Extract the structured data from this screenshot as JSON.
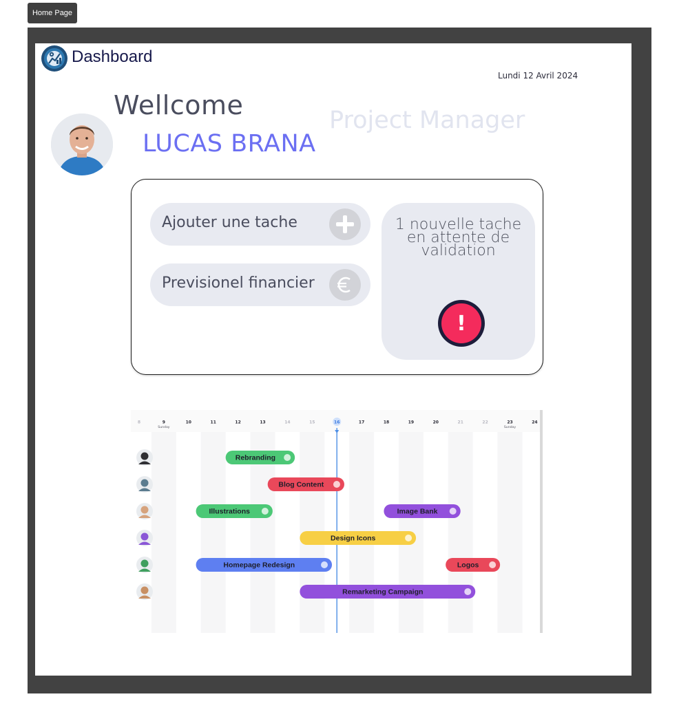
{
  "top_button": "Home Page",
  "header": {
    "title": "Dashboard",
    "date": "Lundi 12 Avril 2024"
  },
  "welcome": {
    "greeting": "Wellcome",
    "name": "LUCAS BRANA",
    "role": "Project Manager"
  },
  "actions": {
    "add_task": "Ajouter une tache",
    "financial": "Previsionel financier",
    "notification": "1 nouvelle tache en attente de validation",
    "alert_symbol": "!"
  },
  "colors": {
    "accent": "#6b6ff2",
    "alert": "#f42b5c",
    "green": "#4cc876",
    "red": "#e9485a",
    "purple": "#9250dc",
    "yellow": "#f7cf45",
    "blue": "#5e7ff1"
  },
  "chart_data": {
    "type": "gantt",
    "days": [
      {
        "d": "8",
        "sub": ""
      },
      {
        "d": "9",
        "sub": "Sunday"
      },
      {
        "d": "10",
        "sub": ""
      },
      {
        "d": "11",
        "sub": ""
      },
      {
        "d": "12",
        "sub": ""
      },
      {
        "d": "13",
        "sub": ""
      },
      {
        "d": "14",
        "sub": ""
      },
      {
        "d": "15",
        "sub": ""
      },
      {
        "d": "16",
        "sub": ""
      },
      {
        "d": "17",
        "sub": ""
      },
      {
        "d": "18",
        "sub": ""
      },
      {
        "d": "19",
        "sub": ""
      },
      {
        "d": "20",
        "sub": ""
      },
      {
        "d": "21",
        "sub": ""
      },
      {
        "d": "22",
        "sub": ""
      },
      {
        "d": "23",
        "sub": "Sunday"
      },
      {
        "d": "24",
        "sub": ""
      }
    ],
    "today": "16",
    "tasks": [
      {
        "name": "Rebranding",
        "row": 0,
        "start": 11.5,
        "end": 14.3,
        "color": "#4cc876"
      },
      {
        "name": "Blog Content",
        "row": 1,
        "start": 13.2,
        "end": 16.3,
        "color": "#e9485a"
      },
      {
        "name": "Illustrations",
        "row": 2,
        "start": 10.3,
        "end": 13.4,
        "color": "#4cc876"
      },
      {
        "name": "Image Bank",
        "row": 2,
        "start": 17.9,
        "end": 21.0,
        "color": "#9250dc"
      },
      {
        "name": "Design Icons",
        "row": 3,
        "start": 14.5,
        "end": 19.2,
        "color": "#f7cf45"
      },
      {
        "name": "Homepage Redesign",
        "row": 4,
        "start": 10.3,
        "end": 15.8,
        "color": "#5e7ff1"
      },
      {
        "name": "Logos",
        "row": 4,
        "start": 20.4,
        "end": 22.6,
        "color": "#e9485a"
      },
      {
        "name": "Remarketing Campaign",
        "row": 5,
        "start": 14.5,
        "end": 21.6,
        "color": "#9250dc"
      }
    ],
    "avatars": [
      "#2f2f33",
      "#5b7c8f",
      "#d6a37d",
      "#8a57d6",
      "#3f9f5e",
      "#c89064"
    ]
  }
}
